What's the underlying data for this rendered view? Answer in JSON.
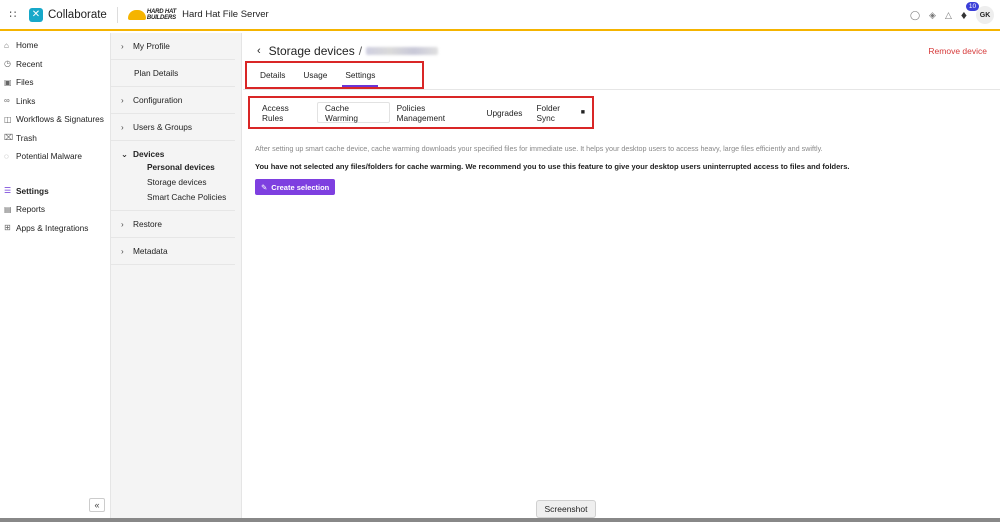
{
  "topbar": {
    "grid_icon": "grid-icon",
    "app_name": "Collaborate",
    "brand_logo_text": "HARD HAT BUILDERS",
    "org_name": "Hard Hat File Server",
    "notification_count": "10",
    "avatar_initials": "GK",
    "accent_color": "#f5b400"
  },
  "sidebar": {
    "items": [
      {
        "label": "Home",
        "icon": "home-icon"
      },
      {
        "label": "Recent",
        "icon": "clock-icon"
      },
      {
        "label": "Files",
        "icon": "files-icon"
      },
      {
        "label": "Links",
        "icon": "link-icon"
      },
      {
        "label": "Workflows & Signatures",
        "icon": "workflow-icon"
      },
      {
        "label": "Trash",
        "icon": "trash-icon"
      },
      {
        "label": "Potential Malware",
        "icon": "shield-icon"
      },
      {
        "label": "Settings",
        "icon": "settings-icon"
      },
      {
        "label": "Reports",
        "icon": "reports-icon"
      },
      {
        "label": "Apps & Integrations",
        "icon": "apps-icon"
      }
    ],
    "collapse_label": "«"
  },
  "subnav": {
    "my_profile": "My Profile",
    "plan_details": "Plan Details",
    "configuration": "Configuration",
    "users_groups": "Users & Groups",
    "devices": "Devices",
    "personal_devices": "Personal devices",
    "storage_devices": "Storage devices",
    "smart_cache": "Smart Cache Policies",
    "restore": "Restore",
    "metadata": "Metadata"
  },
  "main": {
    "title": "Storage devices",
    "separator": "/",
    "remove_label": "Remove device",
    "tabs": [
      "Details",
      "Usage",
      "Settings"
    ],
    "subtabs": [
      "Access Rules",
      "Cache Warming",
      "Policies Management",
      "Upgrades",
      "Folder Sync"
    ],
    "info_text": "After setting up smart cache device, cache warming downloads your specified files for immediate use. It helps your desktop users to access heavy, large files efficiently and swiftly.",
    "warn_text": "You have not selected any files/folders for cache warming. We recommend you to use this feature to give your desktop users uninterrupted access to files and folders.",
    "create_label": "Create selection",
    "accent_color": "#7e3fe0",
    "highlight_color": "#d92626"
  },
  "overlay": {
    "screenshot_label": "Screenshot"
  }
}
